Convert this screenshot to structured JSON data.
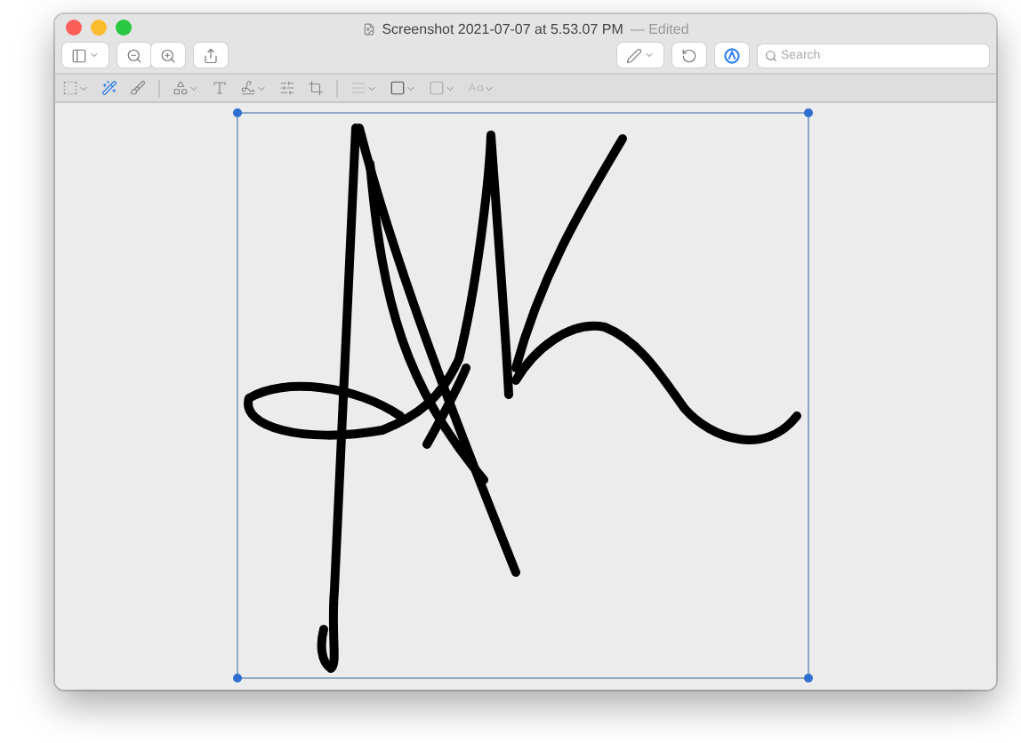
{
  "window": {
    "title": "Screenshot 2021-07-07 at 5.53.07 PM",
    "status": "— Edited"
  },
  "search": {
    "placeholder": "Search"
  },
  "markup": {
    "on": true
  },
  "instant_alpha": {
    "selected": true
  }
}
